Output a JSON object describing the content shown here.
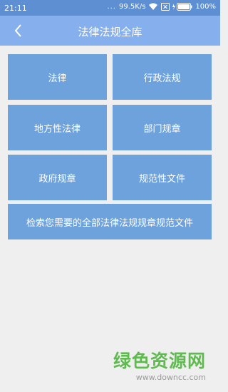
{
  "status_bar": {
    "time": "21:11",
    "dots": "...",
    "network_speed": "99.5K/s",
    "battery": "100%"
  },
  "app_bar": {
    "title": "法律法规全库"
  },
  "categories": [
    {
      "label": "法律"
    },
    {
      "label": "行政法规"
    },
    {
      "label": "地方性法律"
    },
    {
      "label": "部门规章"
    },
    {
      "label": "政府规章"
    },
    {
      "label": "规范性文件"
    }
  ],
  "search_tile": {
    "label": "检索您需要的全部法律法规规章规范文件"
  },
  "watermark": {
    "title": "绿色资源网",
    "url": "www.downcc.com"
  },
  "colors": {
    "status_bar": "#5d8fd2",
    "app_bar": "#86b0ed",
    "tile": "#6ea2dd",
    "background": "#efefef",
    "watermark_green": "#5fba4f"
  }
}
